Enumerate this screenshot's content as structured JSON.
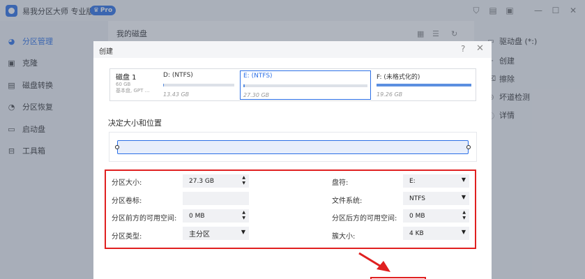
{
  "app": {
    "title": "易我分区大师 专业版",
    "pro_badge": "Pro"
  },
  "window_controls": [
    "shirt-icon",
    "note-icon",
    "menu-box-icon",
    "minimize-icon",
    "maximize-icon",
    "close-icon"
  ],
  "sidebar": {
    "items": [
      {
        "label": "分区管理",
        "icon": "pie-chart-icon",
        "active": true
      },
      {
        "label": "克隆",
        "icon": "clone-icon",
        "active": false
      },
      {
        "label": "磁盘转换",
        "icon": "convert-icon",
        "active": false
      },
      {
        "label": "分区恢复",
        "icon": "restore-icon",
        "active": false
      },
      {
        "label": "启动盘",
        "icon": "boot-disk-icon",
        "active": false
      },
      {
        "label": "工具箱",
        "icon": "toolbox-icon",
        "active": false
      }
    ]
  },
  "content": {
    "title": "我的磁盘"
  },
  "right_panel": {
    "items": [
      {
        "label": "驱动盘 (*:)",
        "icon": "drive-icon"
      },
      {
        "label": "创建",
        "icon": "create-icon"
      },
      {
        "label": "擦除",
        "icon": "wipe-icon"
      },
      {
        "label": "坏道检测",
        "icon": "scan-icon"
      },
      {
        "label": "详情",
        "icon": "details-icon"
      }
    ]
  },
  "dialog": {
    "title": "创建",
    "help": "?",
    "close": "✕",
    "disk": {
      "name": "磁盘 1",
      "size": "60 GB",
      "type": "基本盘, GPT …"
    },
    "partitions": [
      {
        "label": "D: (NTFS)",
        "size": "13.43 GB",
        "fill": 0.01,
        "selected": false
      },
      {
        "label": "E: (NTFS)",
        "size": "27.30 GB",
        "fill": 0.01,
        "selected": true
      },
      {
        "label": "F: (未格式化的)",
        "size": "19.26 GB",
        "fill": 1.0,
        "selected": false
      }
    ],
    "position_title": "决定大小和位置",
    "form": {
      "size_label": "分区大小:",
      "size_value": "27.3 GB",
      "drive_letter_label": "盘符:",
      "drive_letter_value": "E:",
      "volume_label_label": "分区卷标:",
      "volume_label_value": "",
      "filesystem_label": "文件系统:",
      "filesystem_value": "NTFS",
      "space_before_label": "分区前方的可用空间:",
      "space_before_value": "0 MB",
      "space_after_label": "分区后方的可用空间:",
      "space_after_value": "0 MB",
      "type_label": "分区类型:",
      "type_value": "主分区",
      "cluster_label": "簇大小:",
      "cluster_value": "4 KB"
    }
  },
  "colors": {
    "accent": "#2b6fe6",
    "highlight_red": "#e02020",
    "overlay": "#505a6e"
  }
}
